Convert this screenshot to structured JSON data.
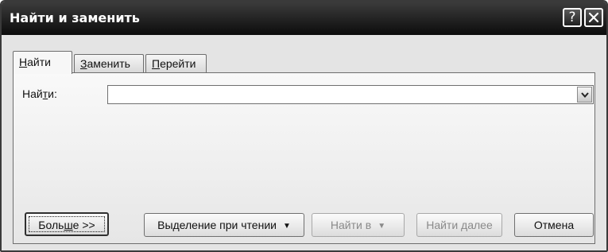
{
  "window": {
    "title": "Найти и заменить",
    "help_glyph": "?"
  },
  "tabs": [
    {
      "pre": "",
      "ul": "Н",
      "post": "айти",
      "active": true
    },
    {
      "pre": "",
      "ul": "З",
      "post": "аменить",
      "active": false
    },
    {
      "pre": "",
      "ul": "П",
      "post": "ерейти",
      "active": false
    }
  ],
  "find": {
    "label_pre": "Най",
    "label_ul": "т",
    "label_post": "и:",
    "value": "",
    "placeholder": ""
  },
  "buttons": {
    "more": {
      "pre": "Боль",
      "ul": "ш",
      "post": "е >>"
    },
    "reading_highlight": {
      "label": "Выделение при чтении",
      "caret": "▼"
    },
    "find_in": {
      "label": "Найти в",
      "caret": "▼"
    },
    "find_next": {
      "label": "Найти далее"
    },
    "cancel": {
      "label": "Отмена"
    }
  },
  "icons": {
    "help": "help-icon",
    "close": "close-icon",
    "dropdown": "chevron-down-icon"
  }
}
